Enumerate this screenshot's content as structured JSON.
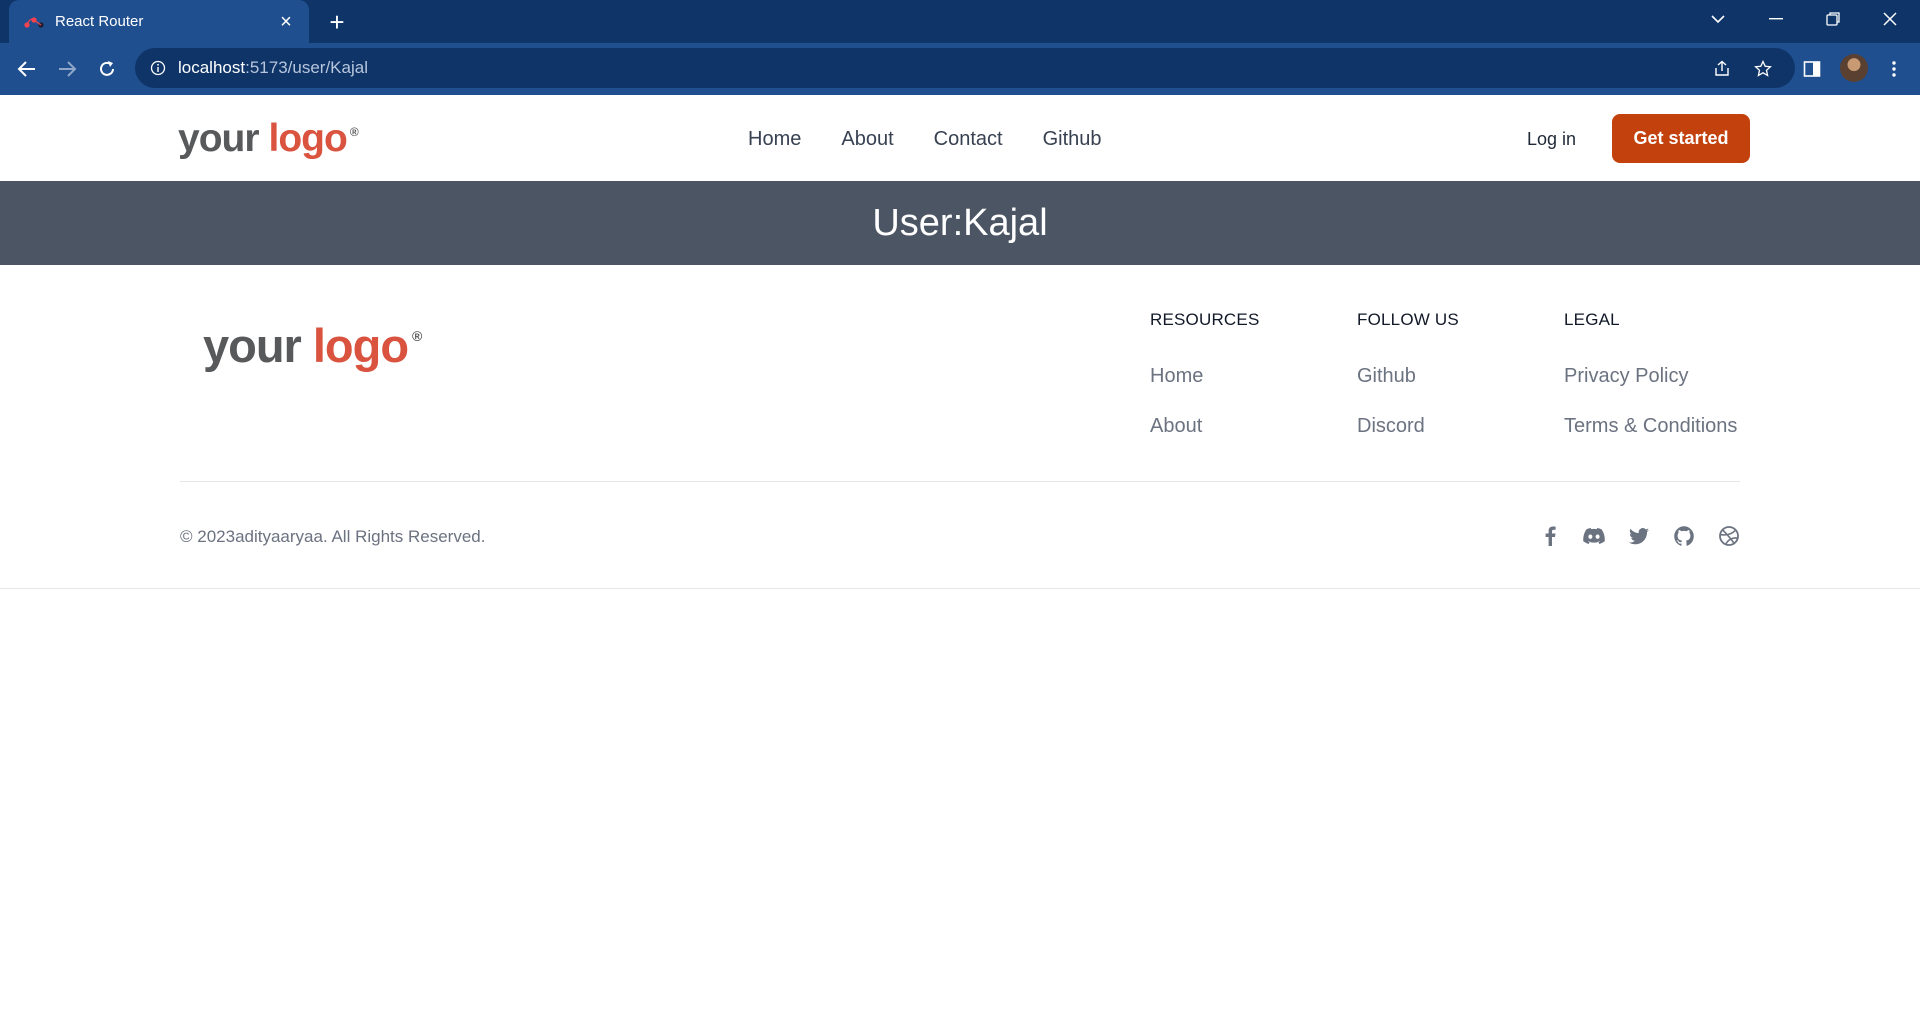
{
  "browser": {
    "tab_title": "React Router",
    "url_host": "localhost",
    "url_path": ":5173/user/Kajal"
  },
  "header": {
    "logo": {
      "word1": "your",
      "word2": "logo",
      "mark": "®"
    },
    "nav": [
      "Home",
      "About",
      "Contact",
      "Github"
    ],
    "login_label": "Log in",
    "cta_label": "Get started"
  },
  "banner": {
    "title": "User:Kajal"
  },
  "footer": {
    "logo": {
      "word1": "your",
      "word2": "logo",
      "mark": "®"
    },
    "columns": [
      {
        "heading": "RESOURCES",
        "links": [
          "Home",
          "About"
        ]
      },
      {
        "heading": "FOLLOW US",
        "links": [
          "Github",
          "Discord"
        ]
      },
      {
        "heading": "LEGAL",
        "links": [
          "Privacy Policy",
          "Terms & Conditions"
        ]
      }
    ],
    "copyright": "© 2023adityaaryaa. All Rights Reserved.",
    "social_icons": [
      "facebook-icon",
      "discord-icon",
      "twitter-icon",
      "github-icon",
      "dribbble-icon"
    ]
  },
  "colors": {
    "browser_frame": "#0f3468",
    "browser_toolbar": "#1f4f8f",
    "cta": "#c2410c",
    "banner": "#4b5563",
    "logo_accent": "#d9533f"
  }
}
